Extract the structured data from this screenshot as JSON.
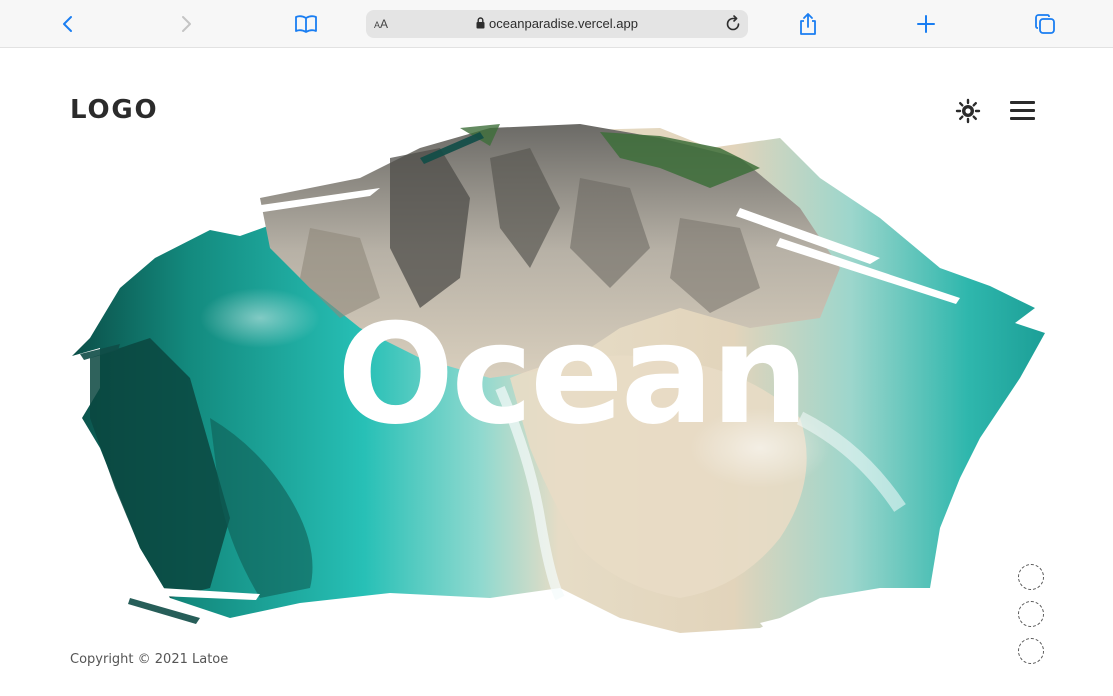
{
  "browser": {
    "url": "oceanparadise.vercel.app",
    "text_size_label_small": "A",
    "text_size_label_big": "A",
    "icons": [
      "back-icon",
      "forward-icon",
      "bookmarks-icon",
      "lock-icon",
      "reload-icon",
      "share-icon",
      "plus-icon",
      "tabs-icon"
    ],
    "accent_color": "#1a7ef2"
  },
  "header": {
    "logo": "LOGO",
    "icons": [
      "sun-icon",
      "menu-icon"
    ]
  },
  "hero": {
    "title": "Ocean",
    "palette": {
      "turquoise": "#1fb5b0",
      "deep_sea": "#0c5a52",
      "sand": "#e9dcc4",
      "rock": "#8e8a84",
      "foam": "#f2f7f7"
    }
  },
  "footer": {
    "copyright": "Copyright © 2021 Latoe"
  },
  "pager": {
    "dots": 3
  }
}
